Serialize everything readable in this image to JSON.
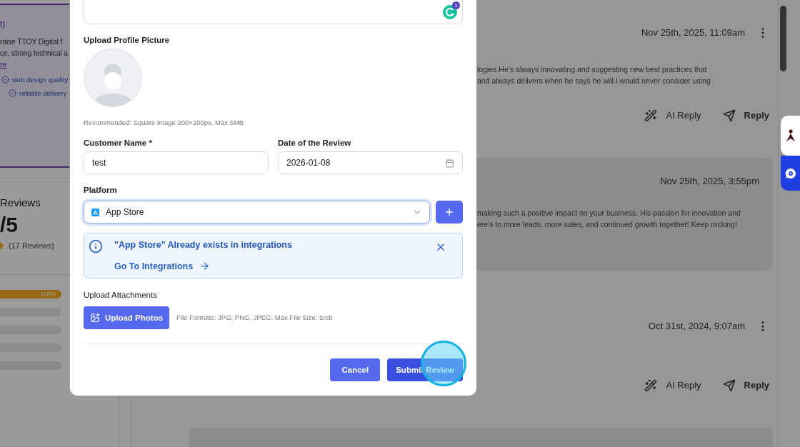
{
  "sidebar": {
    "card": {
      "title": "t)",
      "text_lines": [
        "raise TTOY Digital f",
        "ce, strong technical a"
      ],
      "link": "re",
      "tags": [
        "web design quality",
        "reliable delivery"
      ]
    },
    "summary": {
      "title": "Reviews",
      "score": "/5",
      "count": "(17 Reviews)",
      "bars": [
        {
          "level": 1,
          "label": "100%"
        },
        {
          "level": 0
        },
        {
          "level": 0
        },
        {
          "level": 0
        },
        {
          "level": 0
        }
      ]
    }
  },
  "reviews": [
    {
      "kind": "review",
      "date": "Nov 25th, 2025, 11:09am",
      "text_lines": [
        "logies.He’s always innovating and suggesting new best practices that",
        "and always delivers when he says he will.I would never consider using"
      ],
      "actions": [
        "AI Reply",
        "Reply"
      ]
    },
    {
      "kind": "reply",
      "date": "Nov 25th, 2025, 3:55pm",
      "text_lines": [
        "making such a positive impact on your business. His passion for innovation and",
        "ere's to more leads, more sales, and continued growth together! Keep rocking!"
      ]
    },
    {
      "kind": "review",
      "date": "Oct 31st, 2024, 9:07am",
      "actions": [
        "AI Reply",
        "Reply"
      ]
    },
    {
      "kind": "reply"
    }
  ],
  "dialog": {
    "description_field": {
      "badge": "1"
    },
    "profile_picture": {
      "label": "Upload Profile Picture",
      "hint": "Recommended: Square image 200×200px, Max 5MB"
    },
    "fields": [
      {
        "kind": "text",
        "label": "Customer Name *",
        "value": "test"
      },
      {
        "kind": "date",
        "label": "Date of the Review",
        "value": "2026-01-08"
      }
    ],
    "platform": {
      "label": "Platform",
      "value": "App Store",
      "focused": true
    },
    "alert": {
      "message": "\"App Store\" Already exists in integrations",
      "link": "Go To Integrations"
    },
    "attachments": {
      "label": "Upload Attachments",
      "button": "Upload Photos",
      "hint": "File Formats: JPG, PNG, JPEG. Max File Size: 5mb"
    },
    "buttons": [
      {
        "kind": "secondary",
        "label": "Cancel",
        "highlighted": false
      },
      {
        "kind": "primary",
        "label": "Submit Review",
        "highlighted": true
      }
    ]
  }
}
